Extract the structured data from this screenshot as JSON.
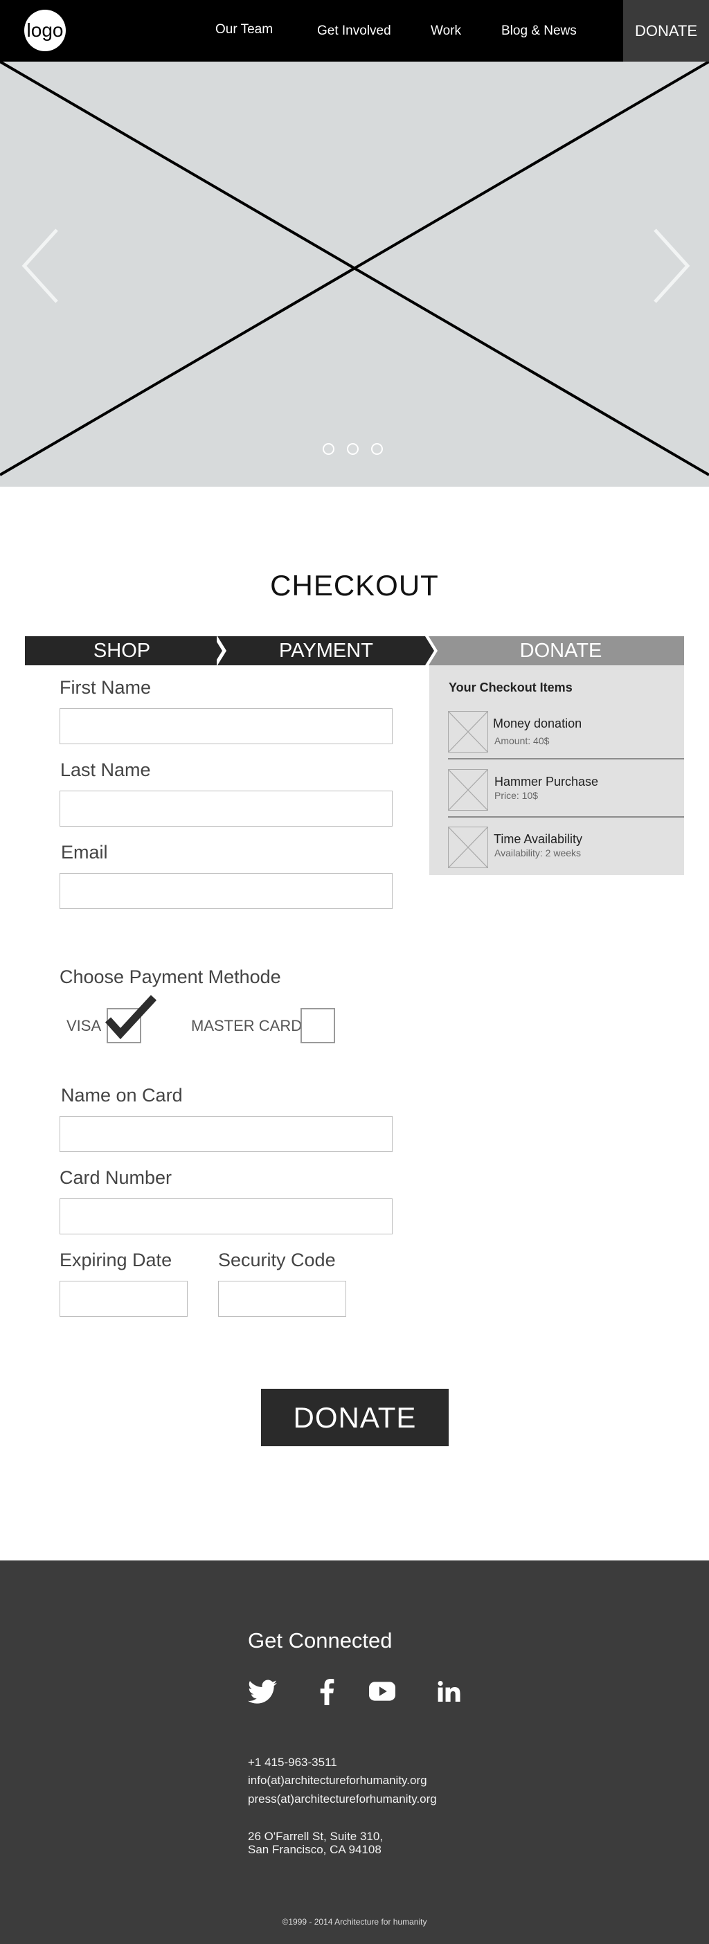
{
  "header": {
    "logo_text": "logo",
    "nav": [
      "Our Team",
      "Get Involved",
      "Work",
      "Blog & News"
    ],
    "donate_label": "DONATE"
  },
  "hero": {
    "slide_count": 3,
    "prev_icon": "chevron-left-icon",
    "next_icon": "chevron-right-icon"
  },
  "checkout": {
    "title": "CHECKOUT",
    "steps": [
      "SHOP",
      "PAYMENT",
      "DONATE"
    ],
    "fields": {
      "first_name": "First Name",
      "last_name": "Last Name",
      "email": "Email",
      "name_on_card": "Name on Card",
      "card_number": "Card Number",
      "expiring_date": "Expiring Date",
      "security_code": "Security Code"
    },
    "payment": {
      "title": "Choose Payment Methode",
      "visa": "VISA",
      "mastercard": "MASTER CARD",
      "visa_checked": true,
      "mastercard_checked": false
    },
    "items_panel": {
      "title": "Your Checkout Items",
      "items": [
        {
          "name": "Money donation",
          "detail": "Amount: 40$"
        },
        {
          "name": "Hammer Purchase",
          "detail": "Price: 10$"
        },
        {
          "name": "Time Availability",
          "detail": "Availability: 2 weeks"
        }
      ]
    },
    "donate_button": "DONATE"
  },
  "footer": {
    "title": "Get Connected",
    "social": [
      "twitter-icon",
      "facebook-icon",
      "youtube-icon",
      "linkedin-icon"
    ],
    "phone": "+1 415-963-3511",
    "email1": "info(at)architectureforhumanity.org",
    "email2": "press(at)architectureforhumanity.org",
    "address1": "26 O'Farrell St, Suite 310,",
    "address2": "San Francisco, CA 94108",
    "copyright": "©1999 - 2014 Architecture for humanity"
  },
  "colors": {
    "header_bg": "#000000",
    "nav_donate_bg": "#3a3a3a",
    "hero_bg": "#d7dadb",
    "step_dark": "#262626",
    "step_active": "#949494",
    "panel_bg": "#e1e1e1",
    "footer_bg": "#3c3c3c"
  }
}
